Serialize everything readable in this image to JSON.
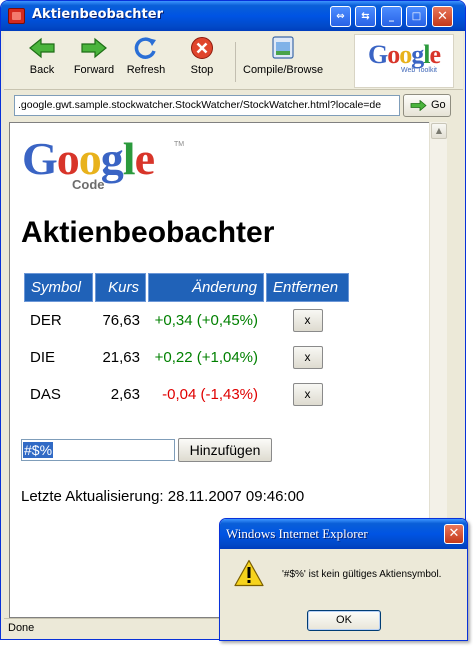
{
  "window": {
    "title": "Aktienbeobachter",
    "buttons": {
      "restore": "⇔",
      "dock": "⇆",
      "minimize": "_",
      "maximize": "□",
      "close": "✕"
    }
  },
  "toolbar": {
    "back": "Back",
    "forward": "Forward",
    "refresh": "Refresh",
    "stop": "Stop",
    "compile": "Compile/Browse",
    "logo_text": "Google",
    "logo_sub": "Web Toolkit"
  },
  "address": {
    "url": ".google.gwt.sample.stockwatcher.StockWatcher/StockWatcher.html?locale=de",
    "go": "Go"
  },
  "page": {
    "logo": {
      "text": "Google",
      "sub": "Code",
      "tm": "TM"
    },
    "title": "Aktienbeobachter",
    "table": {
      "headers": [
        "Symbol",
        "Kurs",
        "Änderung",
        "Entfernen"
      ],
      "rows": [
        {
          "symbol": "DER",
          "price": "76,63",
          "change": "+0,34 (+0,45%)",
          "remove": "x",
          "trend": "up"
        },
        {
          "symbol": "DIE",
          "price": "21,63",
          "change": "+0,22 (+1,04%)",
          "remove": "x",
          "trend": "up"
        },
        {
          "symbol": "DAS",
          "price": "2,63",
          "change": "-0,04 (-1,43%)",
          "remove": "x",
          "trend": "down"
        }
      ]
    },
    "input_value": "#$%",
    "add_label": "Hinzufügen",
    "last_update": "Letzte Aktualisierung: 28.11.2007 09:46:00"
  },
  "status": "Done",
  "dialog": {
    "title": "Windows Internet Explorer",
    "message": "'#$%' ist kein gültiges Aktiensymbol.",
    "ok": "OK",
    "close": "✕",
    "icon_mark": "!"
  },
  "colors": {
    "positive": "#008000",
    "negative": "#e00000",
    "header_bg": "#2062b8",
    "titlebar": "#0054e3"
  }
}
